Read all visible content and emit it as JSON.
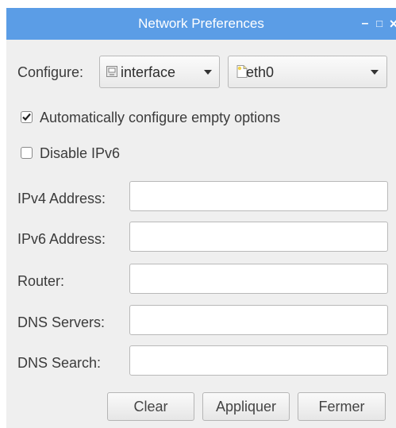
{
  "window": {
    "title": "Network Preferences",
    "controls": {
      "minimize": "–",
      "maximize": "□",
      "close": "×"
    }
  },
  "configure": {
    "label": "Configure:",
    "type_value": "interface",
    "type_icon": "network-interface-icon",
    "interface_value": "eth0",
    "interface_icon": "document-icon"
  },
  "options": {
    "auto_configure": {
      "label": "Automatically configure empty options",
      "checked": true
    },
    "disable_ipv6": {
      "label": "Disable IPv6",
      "checked": false
    }
  },
  "fields": [
    {
      "label": "IPv4 Address:",
      "value": ""
    },
    {
      "label": "IPv6 Address:",
      "value": ""
    },
    {
      "label": "Router:",
      "value": ""
    },
    {
      "label": "DNS Servers:",
      "value": ""
    },
    {
      "label": "DNS Search:",
      "value": ""
    }
  ],
  "buttons": {
    "clear": "Clear",
    "apply": "Appliquer",
    "close": "Fermer"
  },
  "colors": {
    "titlebar": "#5b9de6",
    "window_bg": "#efefef"
  }
}
